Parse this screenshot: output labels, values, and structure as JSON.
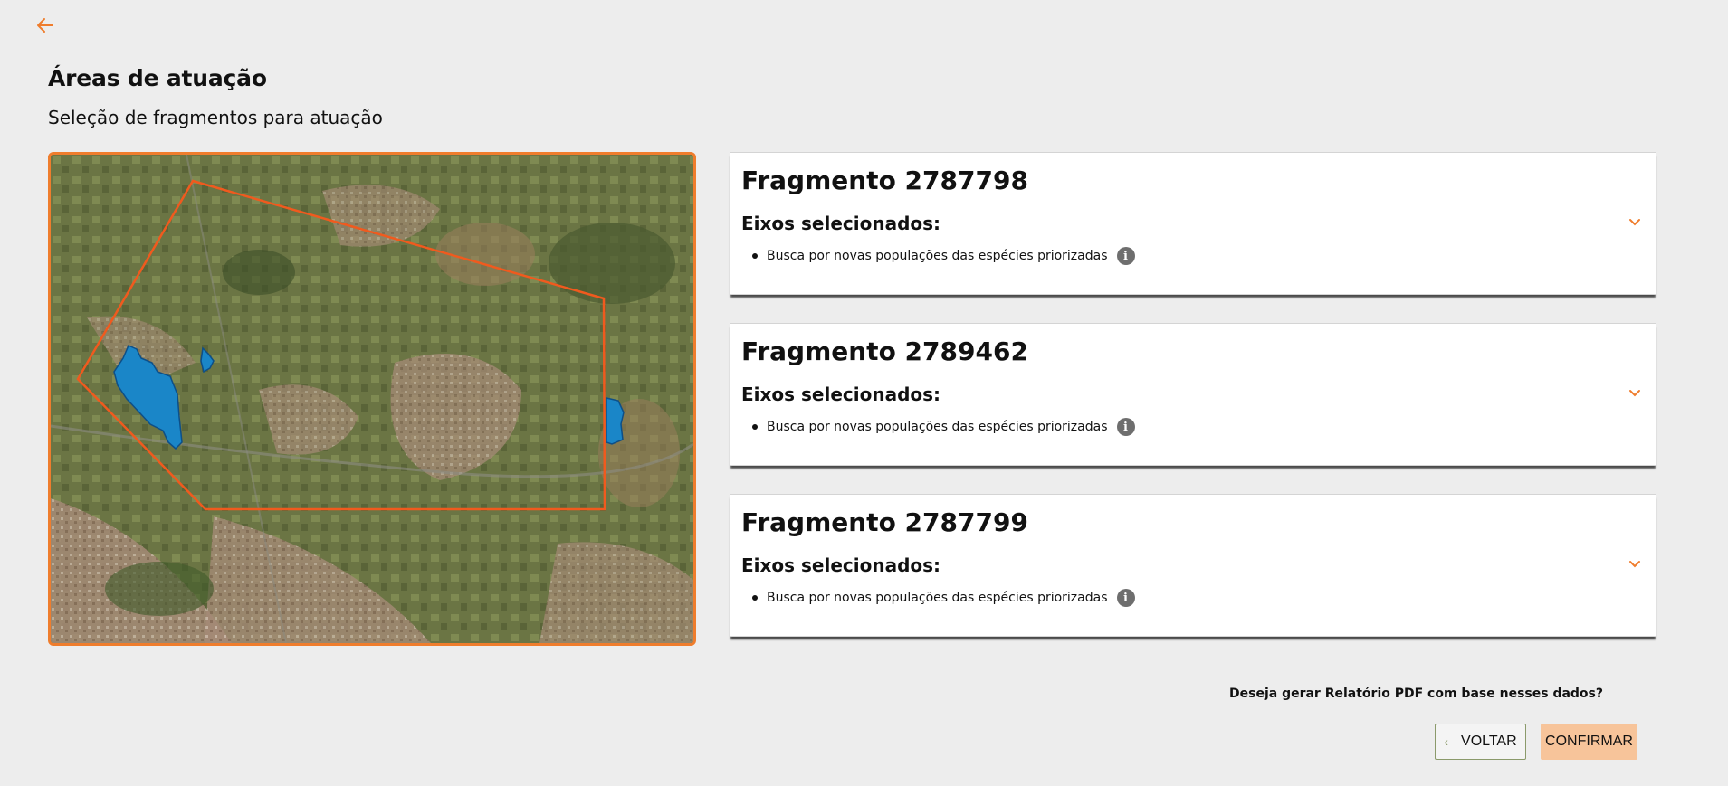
{
  "nav": {
    "back_icon": "arrow-left-icon"
  },
  "header": {
    "title": "Áreas de atuação",
    "subtitle": "Seleção de fragmentos para atuação"
  },
  "colors": {
    "accent": "#ef7d2d",
    "polygon_outline": "#f05a1e",
    "fragment_fill": "#1a86c8",
    "confirm_button": "#f7c49a",
    "card_background": "#ffffff"
  },
  "fragments": [
    {
      "title": "Fragmento 2787798",
      "axes_label": "Eixos selecionados:",
      "items": [
        "Busca por novas populações das espécies priorizadas"
      ]
    },
    {
      "title": "Fragmento 2789462",
      "axes_label": "Eixos selecionados:",
      "items": [
        "Busca por novas populações das espécies priorizadas"
      ]
    },
    {
      "title": "Fragmento 2787799",
      "axes_label": "Eixos selecionados:",
      "items": [
        "Busca por novas populações das espécies priorizadas"
      ]
    }
  ],
  "footer": {
    "question": "Deseja gerar Relatório PDF com base nesses dados?",
    "back_label": "VOLTAR",
    "confirm_label": "CONFIRMAR"
  }
}
